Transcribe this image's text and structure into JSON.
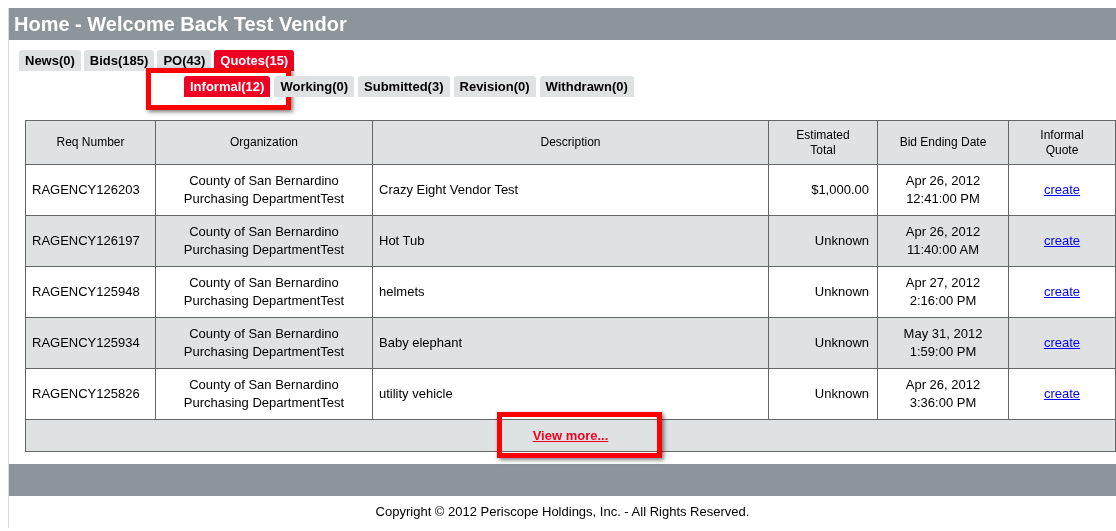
{
  "header": {
    "title": "Home - Welcome Back Test Vendor"
  },
  "tabs": [
    {
      "label": "News(0)",
      "selected": false
    },
    {
      "label": "Bids(185)",
      "selected": false
    },
    {
      "label": "PO(43)",
      "selected": false
    },
    {
      "label": "Quotes(15)",
      "selected": true
    }
  ],
  "subtabs": [
    {
      "label": "Informal(12)",
      "selected": true,
      "highlighted": true
    },
    {
      "label": "Working(0)",
      "selected": false,
      "highlighted": false
    },
    {
      "label": "Submitted(3)",
      "selected": false,
      "highlighted": false
    },
    {
      "label": "Revision(0)",
      "selected": false,
      "highlighted": false
    },
    {
      "label": "Withdrawn(0)",
      "selected": false,
      "highlighted": false
    }
  ],
  "table": {
    "columns": [
      "Req Number",
      "Organization",
      "Description",
      "Estimated Total",
      "Bid Ending Date",
      "Informal Quote"
    ],
    "rows": [
      {
        "req": "RAGENCY126203",
        "org": [
          "County of San Bernardino",
          "Purchasing DepartmentTest"
        ],
        "description": "Crazy Eight Vendor Test",
        "total": "$1,000.00",
        "date": [
          "Apr 26, 2012",
          "12:41:00 PM"
        ],
        "link": "create"
      },
      {
        "req": "RAGENCY126197",
        "org": [
          "County of San Bernardino",
          "Purchasing DepartmentTest"
        ],
        "description": "Hot Tub",
        "total": "Unknown",
        "date": [
          "Apr 26, 2012",
          "11:40:00 AM"
        ],
        "link": "create"
      },
      {
        "req": "RAGENCY125948",
        "org": [
          "County of San Bernardino",
          "Purchasing DepartmentTest"
        ],
        "description": "helmets",
        "total": "Unknown",
        "date": [
          "Apr 27, 2012",
          "2:16:00 PM"
        ],
        "link": "create"
      },
      {
        "req": "RAGENCY125934",
        "org": [
          "County of San Bernardino",
          "Purchasing DepartmentTest"
        ],
        "description": "Baby elephant",
        "total": "Unknown",
        "date": [
          "May 31, 2012",
          "1:59:00 PM"
        ],
        "link": "create"
      },
      {
        "req": "RAGENCY125826",
        "org": [
          "County of San Bernardino",
          "Purchasing DepartmentTest"
        ],
        "description": "utility vehicle",
        "total": "Unknown",
        "date": [
          "Apr 26, 2012",
          "3:36:00 PM"
        ],
        "link": "create"
      }
    ],
    "view_more": {
      "label": "View more...",
      "highlighted": true
    }
  },
  "footer": {
    "copyright": "Copyright © 2012 Periscope Holdings, Inc. - All Rights Reserved."
  }
}
